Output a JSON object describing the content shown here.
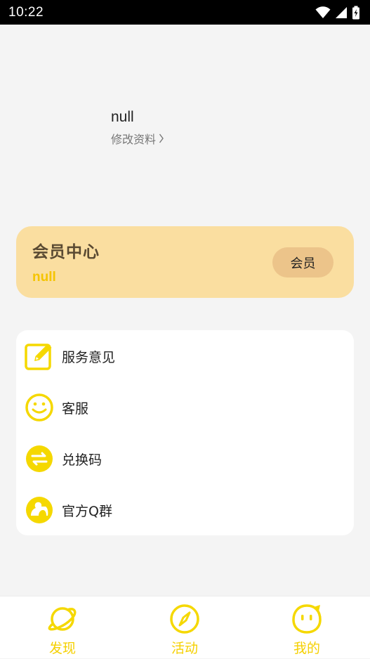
{
  "status_bar": {
    "time": "10:22"
  },
  "profile": {
    "name": "null",
    "edit_label": "修改资料"
  },
  "vip_card": {
    "title": "会员中心",
    "subtitle": "null",
    "button_label": "会员"
  },
  "menu": {
    "items": [
      {
        "label": "服务意见",
        "icon": "edit-icon"
      },
      {
        "label": "客服",
        "icon": "smile-icon"
      },
      {
        "label": "兑换码",
        "icon": "exchange-icon"
      },
      {
        "label": "官方Q群",
        "icon": "group-icon"
      }
    ]
  },
  "bottom_nav": {
    "items": [
      {
        "label": "发现",
        "icon": "planet-icon"
      },
      {
        "label": "活动",
        "icon": "compass-icon"
      },
      {
        "label": "我的",
        "icon": "face-icon"
      }
    ]
  },
  "colors": {
    "accent": "#f5d000",
    "vip_bg": "#fadea0",
    "vip_button": "#ecc48a"
  }
}
